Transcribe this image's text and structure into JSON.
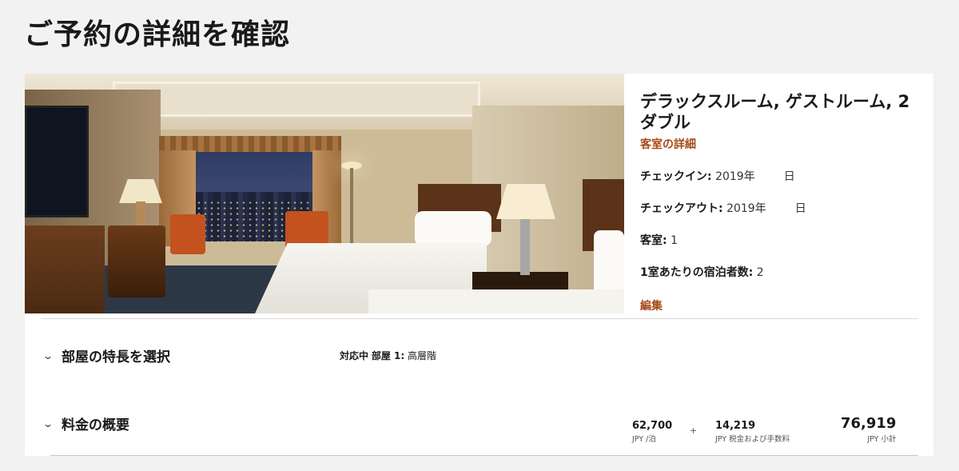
{
  "page": {
    "title": "ご予約の詳細を確認"
  },
  "room": {
    "name": "デラックスルーム, ゲストルーム, 2 ダブル",
    "details_link": "客室の詳細",
    "checkin_label": "チェックイン:",
    "checkin_year": "2019年",
    "checkin_day": "日",
    "checkout_label": "チェックアウト:",
    "checkout_year": "2019年",
    "checkout_day": "日",
    "rooms_label": "客室:",
    "rooms_value": "1",
    "guests_label": "1室あたりの宿泊者数:",
    "guests_value": "2",
    "edit_link": "編集"
  },
  "features": {
    "title": "部屋の特長を選択",
    "status": "対応中",
    "room_label": "部屋 1:",
    "room_value": "高層階"
  },
  "rates": {
    "title": "料金の概要",
    "nightly_amount": "62,700",
    "nightly_unit": "JPY /泊",
    "plus": "+",
    "tax_amount": "14,219",
    "tax_unit": "JPY 税金および手数料",
    "total_amount": "76,919",
    "total_unit": "JPY 小計"
  }
}
